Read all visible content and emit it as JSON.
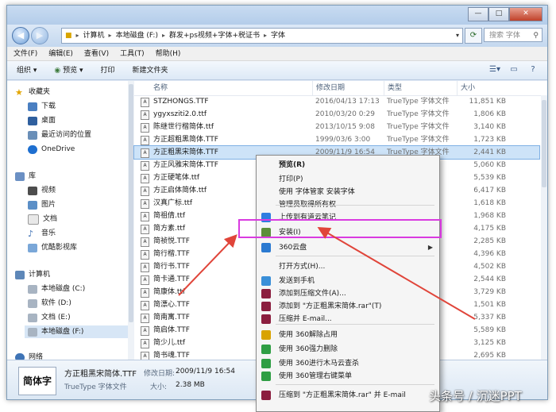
{
  "window": {
    "min": "—",
    "max": "□",
    "close": "✕"
  },
  "address": {
    "segments": [
      "计算机",
      "本地磁盘 (F:)",
      "群发+ps视频+字体+税证书",
      "字体"
    ],
    "search_placeholder": "搜索 字体"
  },
  "menubar": [
    "文件(F)",
    "编辑(E)",
    "查看(V)",
    "工具(T)",
    "帮助(H)"
  ],
  "toolbar": [
    "组织 ▾",
    "预览 ▾",
    "打印",
    "新建文件夹"
  ],
  "sidebar": {
    "favorites": "收藏夹",
    "fav_items": [
      "下载",
      "桌面",
      "最近访问的位置"
    ],
    "onedrive": "OneDrive",
    "library": "库",
    "lib_items": [
      "视频",
      "图片",
      "文档",
      "音乐",
      "优酷影视库"
    ],
    "computer": "计算机",
    "drives": [
      "本地磁盘 (C:)",
      "软件 (D:)",
      "文档 (E:)",
      "本地磁盘 (F:)"
    ],
    "network": "网络"
  },
  "columns": [
    "名称",
    "修改日期",
    "类型",
    "大小"
  ],
  "files": [
    {
      "name": "STZHONGS.TTF",
      "date": "2016/04/13 17:13",
      "type": "TrueType 字体文件",
      "size": "11,851 KB"
    },
    {
      "name": "ygyxsziti2.0.ttf",
      "date": "2010/03/20 0:29",
      "type": "TrueType 字体文件",
      "size": "1,806 KB"
    },
    {
      "name": "陈继世行楷简体.ttf",
      "date": "2013/10/15 9:08",
      "type": "TrueType 字体文件",
      "size": "3,140 KB"
    },
    {
      "name": "方正超粗黑简体.TTF",
      "date": "1999/03/6 3:00",
      "type": "TrueType 字体文件",
      "size": "1,723 KB"
    },
    {
      "name": "方正粗黑宋简体.TTF",
      "date": "2009/11/9 16:54",
      "type": "TrueType 字体文件",
      "size": "2,441 KB"
    },
    {
      "name": "方正风雅宋简体.TTF",
      "date": "",
      "type": "",
      "size": "5,060 KB"
    },
    {
      "name": "方正硬笔体.ttf",
      "date": "",
      "type": "",
      "size": "5,539 KB"
    },
    {
      "name": "方正启体简体.ttf",
      "date": "",
      "type": "",
      "size": "6,417 KB"
    },
    {
      "name": "汉真广标.ttf",
      "date": "",
      "type": "",
      "size": "1,618 KB"
    },
    {
      "name": "简祖倩.ttf",
      "date": "",
      "type": "",
      "size": "1,968 KB"
    },
    {
      "name": "简方素.ttf",
      "date": "",
      "type": "",
      "size": "4,175 KB"
    },
    {
      "name": "简祯悦.TTF",
      "date": "",
      "type": "",
      "size": "2,285 KB"
    },
    {
      "name": "简行楷.TTF",
      "date": "",
      "type": "",
      "size": "4,396 KB"
    },
    {
      "name": "简行书.TTF",
      "date": "",
      "type": "",
      "size": "4,502 KB"
    },
    {
      "name": "简卡通.TTF",
      "date": "",
      "type": "",
      "size": "2,544 KB"
    },
    {
      "name": "简康体.ttf",
      "date": "",
      "type": "",
      "size": "3,729 KB"
    },
    {
      "name": "简漂心.TTF",
      "date": "",
      "type": "",
      "size": "1,501 KB"
    },
    {
      "name": "简南寓.TTF",
      "date": "",
      "type": "",
      "size": "5,337 KB"
    },
    {
      "name": "简启体.TTF",
      "date": "",
      "type": "",
      "size": "5,589 KB"
    },
    {
      "name": "简少儿.ttf",
      "date": "",
      "type": "",
      "size": "3,125 KB"
    },
    {
      "name": "简书魂.TTF",
      "date": "",
      "type": "",
      "size": "2,695 KB"
    }
  ],
  "details": {
    "thumb": "简体字",
    "name": "方正粗黑宋简体.TTF",
    "modified_label": "修改日期:",
    "modified": "2009/11/9 16:54",
    "type": "TrueType 字体文件",
    "size_label": "大小:",
    "size": "2.38 MB"
  },
  "context_menu": [
    {
      "label": "预览(R)",
      "bold": true
    },
    {
      "label": "打印(P)"
    },
    {
      "label": "使用 字体管家 安装字体"
    },
    {
      "label": "管理员取得所有权"
    },
    {
      "label": "上传到有道云笔记"
    },
    {
      "label": "安装(I)"
    },
    {
      "label": "360云盘",
      "submenu": true
    },
    {
      "label": "打开方式(H)..."
    },
    {
      "label": "发送到手机"
    },
    {
      "label": "添加到压缩文件(A)..."
    },
    {
      "label": "添加到 \"方正粗黑宋简体.rar\"(T)"
    },
    {
      "label": "压缩并 E-mail..."
    },
    {
      "label": "使用 360解除占用"
    },
    {
      "label": "使用 360强力删除"
    },
    {
      "label": "使用 360进行木马云查杀"
    },
    {
      "label": "使用 360管理右键菜单"
    },
    {
      "label": "压缩到 \"方正粗黑宋简体.rar\" 并 E-mail"
    }
  ],
  "watermark": "头条号 / 沉迷PPT",
  "colors": {
    "highlight": "#d93be0",
    "arrow": "#e0453a",
    "selection": "#cde3f8"
  }
}
